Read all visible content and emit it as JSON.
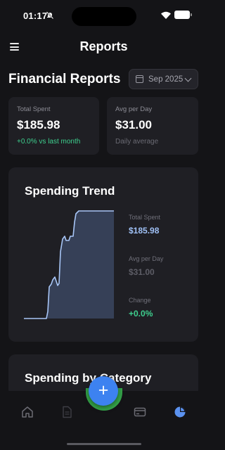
{
  "status": {
    "time": "01:17"
  },
  "header": {
    "title": "Reports"
  },
  "section": {
    "title": "Financial Reports",
    "month": "Sep 2025"
  },
  "stats": {
    "total": {
      "label": "Total Spent",
      "value": "$185.98",
      "sub": "+0.0% vs last month"
    },
    "avg": {
      "label": "Avg per Day",
      "value": "$31.00",
      "sub": "Daily average"
    }
  },
  "trend": {
    "title": "Spending Trend",
    "side": [
      {
        "label": "Total Spent",
        "value": "$185.98",
        "color": "#9fc0f5"
      },
      {
        "label": "Avg per Day",
        "value": "$31.00",
        "color": "#5d5d66"
      },
      {
        "label": "Change",
        "value": "+0.0%",
        "color": "#3ecf8e"
      }
    ]
  },
  "category": {
    "title": "Spending by Category"
  },
  "nav": {
    "items": [
      {
        "icon": "home-icon"
      },
      {
        "icon": "document-icon"
      },
      {
        "icon": "card-icon"
      },
      {
        "icon": "pie-chart-icon",
        "active": true
      }
    ],
    "fab_label": "+"
  },
  "colors": {
    "accent": "#3d82f0",
    "green": "#3ecf8e",
    "background": "#141417",
    "card": "#1f1f24"
  }
}
